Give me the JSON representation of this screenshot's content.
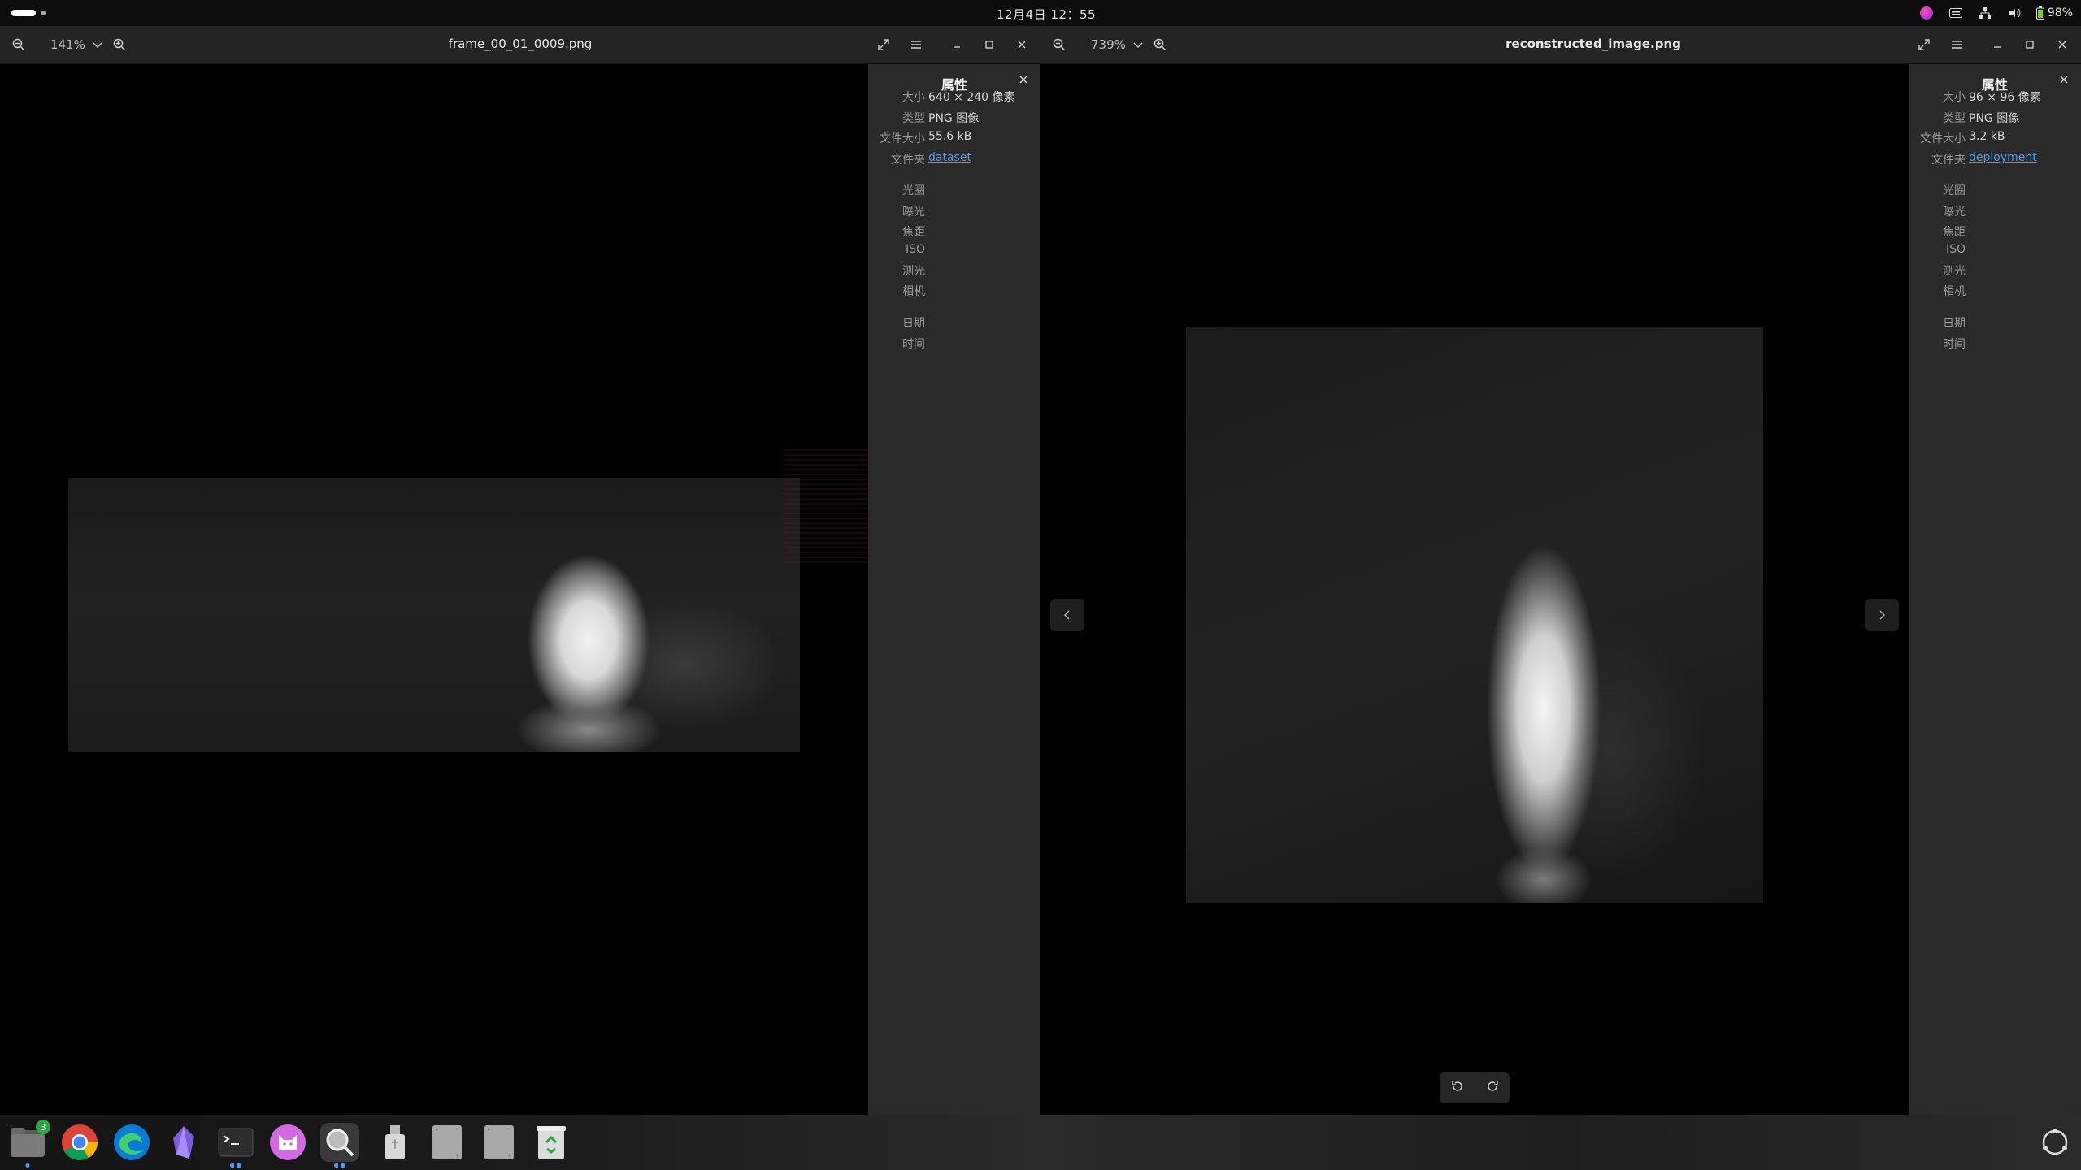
{
  "topbar": {
    "clock": "12月4日 12：55",
    "battery": "98%"
  },
  "left_window": {
    "zoom": "141%",
    "title": "frame_00_01_0009.png",
    "properties": {
      "header": "属性",
      "size_label": "大小",
      "size_value": "640 × 240 像素",
      "type_label": "类型",
      "type_value": "PNG 图像",
      "filesize_label": "文件大小",
      "filesize_value": "55.6 kB",
      "folder_label": "文件夹",
      "folder_value": "dataset",
      "aperture_label": "光圈",
      "exposure_label": "曝光",
      "focal_label": "焦距",
      "iso_label": "ISO",
      "metering_label": "测光",
      "camera_label": "相机",
      "date_label": "日期",
      "time_label": "时间"
    }
  },
  "right_window": {
    "zoom": "739%",
    "title": "reconstructed_image.png",
    "properties": {
      "header": "属性",
      "size_label": "大小",
      "size_value": "96 × 96 像素",
      "type_label": "类型",
      "type_value": "PNG 图像",
      "filesize_label": "文件大小",
      "filesize_value": "3.2 kB",
      "folder_label": "文件夹",
      "folder_value": "deployment",
      "aperture_label": "光圈",
      "exposure_label": "曝光",
      "focal_label": "焦距",
      "iso_label": "ISO",
      "metering_label": "测光",
      "camera_label": "相机",
      "date_label": "日期",
      "time_label": "时间"
    }
  },
  "dock": {
    "files_badge": "3",
    "items": [
      "files-icon",
      "chrome-icon",
      "edge-icon",
      "obsidian-icon",
      "terminal-icon",
      "cat-app-icon",
      "image-viewer-icon",
      "usb-drive-icon",
      "ssd-drive-icon",
      "ssd-drive-icon",
      "trash-icon"
    ]
  },
  "colors": {
    "headerbar": "#242424",
    "props_panel": "#2a2a2a",
    "link": "#4d9bf0",
    "accent_dot": "#4a9bff"
  }
}
